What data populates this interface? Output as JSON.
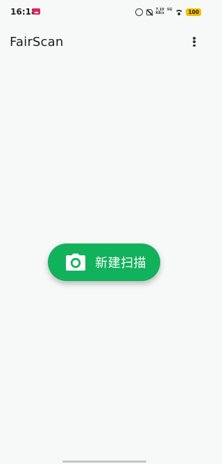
{
  "status_bar": {
    "time": "16:18",
    "notification_icon": "app-notification-icon",
    "network_speed_value": "7.10",
    "network_speed_unit": "KB/s",
    "signal_label": "5G",
    "battery": "100"
  },
  "app_bar": {
    "title": "FairScan",
    "menu_icon": "more-vert-icon"
  },
  "main": {
    "scan_button_label": "新建扫描",
    "scan_button_icon": "camera-icon"
  },
  "colors": {
    "background": "#f6f9f7",
    "accent": "#12b15c",
    "battery": "#f2c200"
  }
}
